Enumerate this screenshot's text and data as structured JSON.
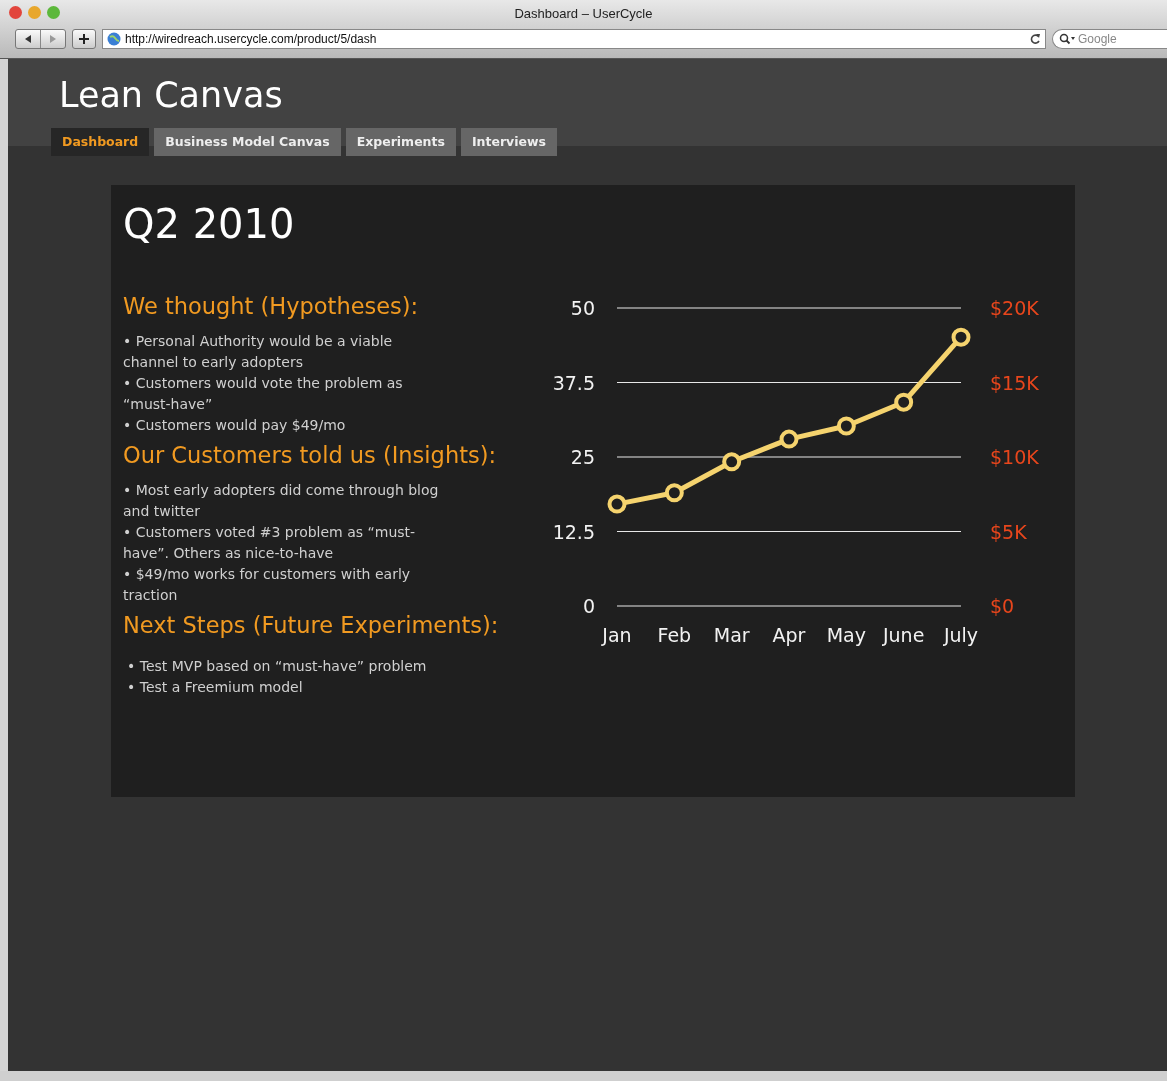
{
  "window": {
    "title": "Dashboard – UserCycle"
  },
  "address_bar": {
    "url": "http://wiredreach.usercycle.com/product/5/dash"
  },
  "search": {
    "placeholder": "Google"
  },
  "app": {
    "title": "Lean Canvas"
  },
  "tabs": [
    {
      "label": "Dashboard",
      "selected": true
    },
    {
      "label": "Business Model Canvas",
      "selected": false
    },
    {
      "label": "Experiments",
      "selected": false
    },
    {
      "label": "Interviews",
      "selected": false
    }
  ],
  "panel": {
    "title": "Q2 2010",
    "sections": [
      {
        "heading": "We thought (Hypotheses):",
        "items": [
          "• Personal Authority would be a viable channel to early adopters",
          "• Customers would vote the problem as “must-have”",
          "• Customers would pay $49/mo"
        ]
      },
      {
        "heading": "Our Customers told us (Insights):",
        "items": [
          "• Most early adopters did come through blog and twitter",
          "• Customers voted #3 problem as “must-have”. Others as nice-to-have",
          "• $49/mo works for customers with early traction"
        ]
      },
      {
        "heading": "Next Steps (Future Experiments):",
        "items": [
          "• Test MVP based on “must-have” problem",
          "• Test a Freemium model"
        ]
      }
    ],
    "chart": {
      "right_axis_labels": [
        "$20K",
        "$15K",
        "$10K",
        "$5K",
        "$0"
      ],
      "chart_data": {
        "type": "line",
        "categories": [
          "Jan",
          "Feb",
          "Mar",
          "Apr",
          "May",
          "June",
          "July"
        ],
        "series": [
          {
            "color": "#f5d36e",
            "marker": "circle",
            "values": [
              17.1,
              19,
              24.2,
              28,
              30.2,
              34.2,
              45.1
            ]
          }
        ],
        "grid": true,
        "ylim": [
          0,
          50
        ],
        "yticks": [
          0,
          12.5,
          25,
          37.5,
          50
        ]
      }
    }
  }
}
